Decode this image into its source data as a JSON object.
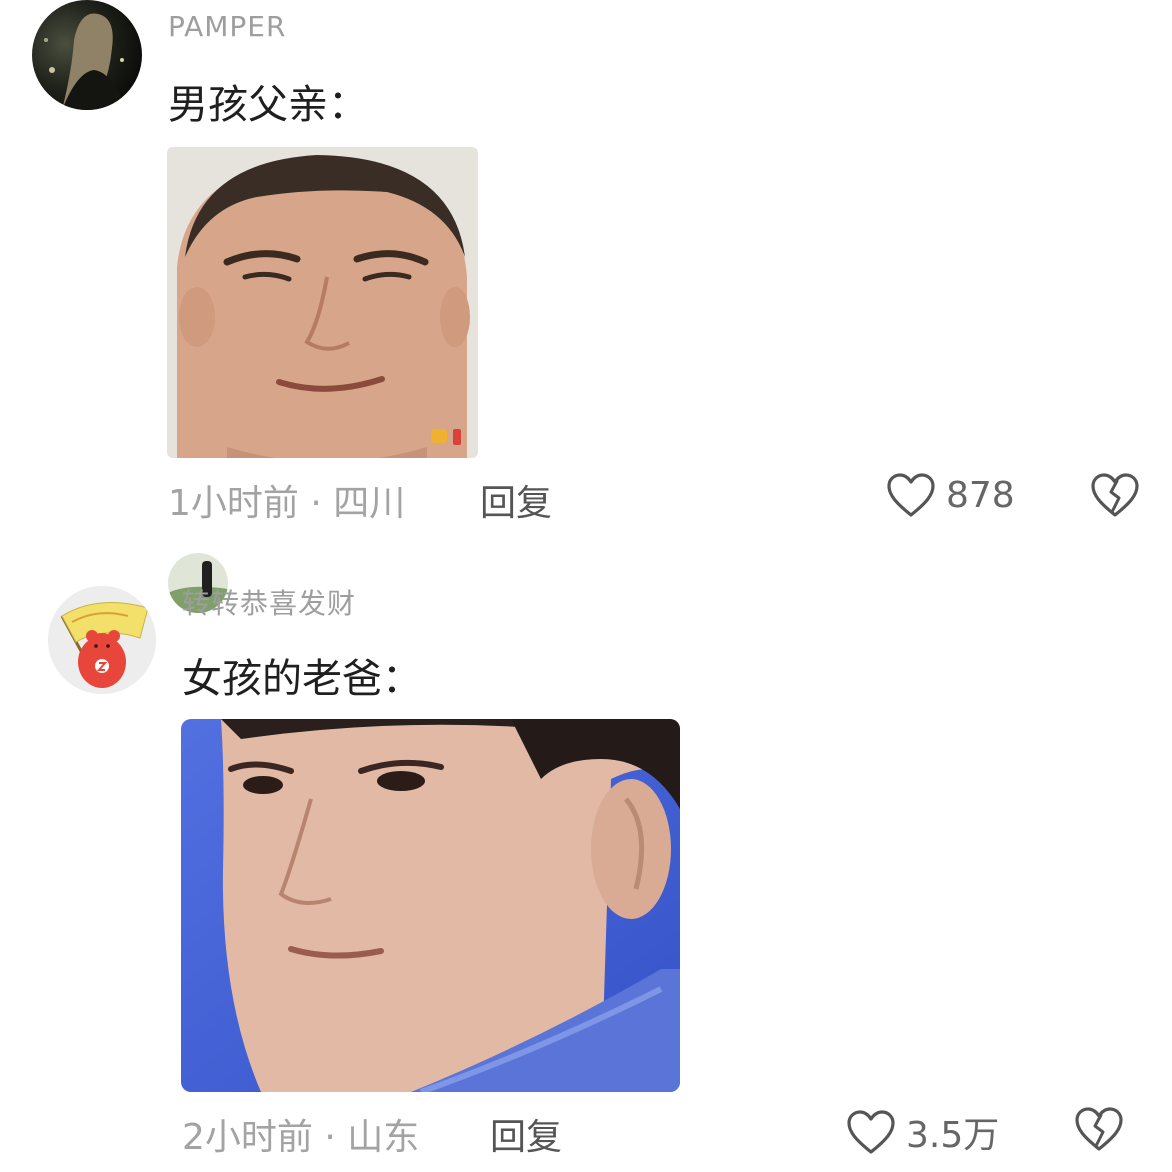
{
  "comments": [
    {
      "username": "PAMPER",
      "text": "男孩父亲：",
      "time_location": "1小时前 · 四川",
      "reply_label": "回复",
      "like_count": "878",
      "avatar_icon": "avatar-photo",
      "sticker_icon": "face-sticker"
    },
    {
      "username": "转转恭喜发财",
      "text": "女孩的老爸：",
      "time_location": "2小时前 · 山东",
      "reply_label": "回复",
      "like_count": "3.5万",
      "avatar_icon": "red-bear-flag-avatar",
      "sticker_icon": "face-sticker"
    }
  ],
  "icons": {
    "like": "heart-outline-icon",
    "dislike": "broken-heart-icon"
  },
  "colors": {
    "text": "#1f1f1f",
    "muted": "#a3a3a3",
    "bear_red": "#e8463a",
    "flag_yellow": "#f2e06b",
    "sticker2_bg": "#3f5fd6"
  }
}
